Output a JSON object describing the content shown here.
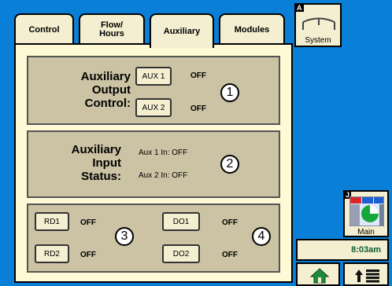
{
  "tabs": [
    {
      "label": "Control",
      "active": false
    },
    {
      "label": "Flow/ Hours",
      "active": false
    },
    {
      "label": "Auxiliary",
      "active": true
    },
    {
      "label": "Modules",
      "active": false
    }
  ],
  "output_control": {
    "title_line1": "Auxiliary",
    "title_line2": "Output",
    "title_line3": "Control:",
    "aux1_label": "AUX 1",
    "aux1_state": "OFF",
    "aux2_label": "AUX 2",
    "aux2_state": "OFF",
    "callout": "1"
  },
  "input_status": {
    "title_line1": "Auxiliary",
    "title_line2": "Input",
    "title_line3": "Status:",
    "aux1_status": "Aux 1 In: OFF",
    "aux2_status": "Aux 2 In: OFF",
    "callout": "2"
  },
  "io": {
    "rd1_label": "RD1",
    "rd1_state": "OFF",
    "rd2_label": "RD2",
    "rd2_state": "OFF",
    "do1_label": "DO1",
    "do1_state": "OFF",
    "do2_label": "DO2",
    "do2_state": "OFF",
    "callout_rd": "3",
    "callout_do": "4"
  },
  "sidebar": {
    "system_badge": "A",
    "system_label": "System",
    "main_badge": "J",
    "main_label": "Main",
    "clock": "8:03am"
  },
  "colors": {
    "background": "#0a7fd8",
    "panel": "#fff9d6",
    "group": "#cbc3a4",
    "button": "#f3efd0"
  }
}
